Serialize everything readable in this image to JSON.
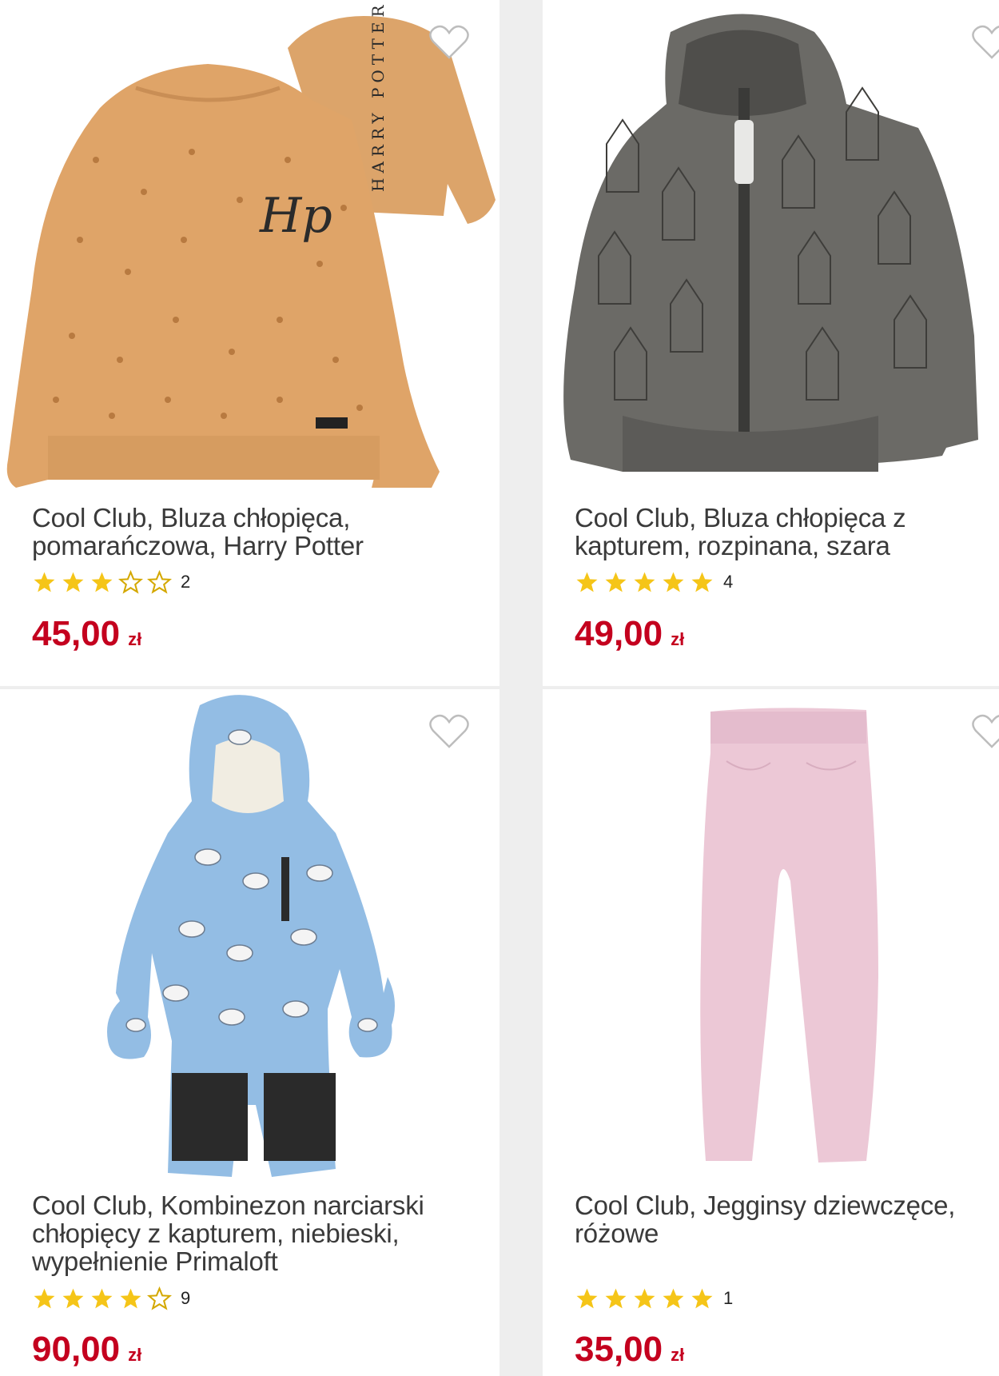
{
  "colors": {
    "price": "#c4001e",
    "star_filled": "#f5c518",
    "star_empty": "#d4a800",
    "background": "#eeeeee"
  },
  "products": [
    {
      "title_line1": "Cool Club, Bluza chłopięca,",
      "title_line2": "pomarańczowa, Harry Potter",
      "title_line3": "",
      "rating": 3,
      "reviews": "2",
      "price": "45,00",
      "currency": "zł",
      "image_icon": "orange-sweatshirt-harry-potter-image",
      "print_text": "HARRY POTTER"
    },
    {
      "title_line1": "Cool Club, Bluza chłopięca z",
      "title_line2": "kapturem, rozpinana, szara",
      "title_line3": "",
      "rating": 5,
      "reviews": "4",
      "price": "49,00",
      "currency": "zł",
      "image_icon": "grey-zip-hoodie-image"
    },
    {
      "title_line1": "Cool Club, Kombinezon narciarski",
      "title_line2": "chłopięcy z kapturem, niebieski,",
      "title_line3": "wypełnienie Primaloft",
      "rating": 4,
      "reviews": "9",
      "price": "90,00",
      "currency": "zł",
      "image_icon": "blue-ski-suit-image"
    },
    {
      "title_line1": "Cool Club, Jegginsy dziewczęce,",
      "title_line2": "różowe",
      "title_line3": "",
      "rating": 5,
      "reviews": "1",
      "price": "35,00",
      "currency": "zł",
      "image_icon": "pink-jeggings-image"
    }
  ]
}
